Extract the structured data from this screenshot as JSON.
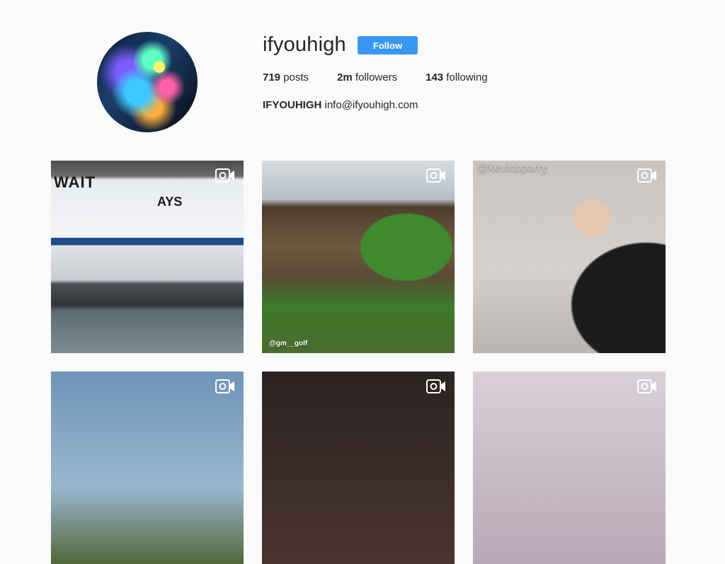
{
  "profile": {
    "username": "ifyouhigh",
    "follow_label": "Follow",
    "posts_count": "719",
    "posts_label": " posts",
    "followers_count": "2m",
    "followers_label": " followers",
    "following_count": "143",
    "following_label": " following",
    "bio_name": "IFYOUHIGH",
    "bio_email": " info@ifyouhigh.com",
    "avatar_icon": "cat-avatar"
  },
  "posts": [
    {
      "media": "video",
      "icon": "video-camera-icon",
      "overlay": "WAIT",
      "overlay2": "AYS"
    },
    {
      "media": "video",
      "icon": "video-camera-icon",
      "overlay": "@gm__golf"
    },
    {
      "media": "video",
      "icon": "video-camera-icon",
      "overlay": "@kevinbparry"
    },
    {
      "media": "video",
      "icon": "video-camera-icon"
    },
    {
      "media": "video",
      "icon": "video-camera-icon"
    },
    {
      "media": "video",
      "icon": "video-camera-icon"
    }
  ],
  "colors": {
    "accent": "#3897f0",
    "background": "#fafafa",
    "text": "#262626"
  }
}
